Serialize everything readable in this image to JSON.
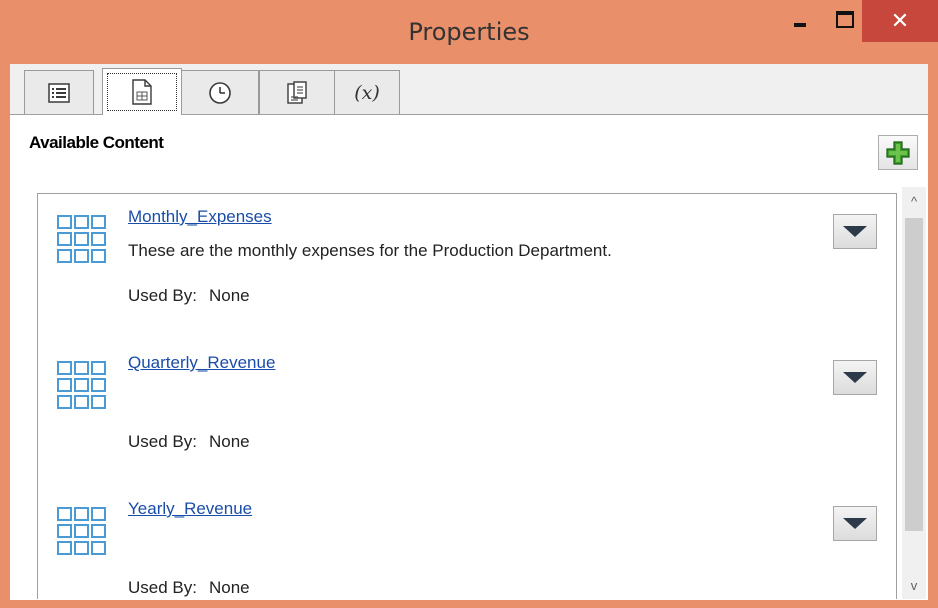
{
  "window": {
    "title": "Properties",
    "close_glyph": "✕",
    "buttons": [
      "minimize-icon",
      "maximize-icon",
      "close-icon"
    ]
  },
  "tabs": [
    {
      "icon": "list-icon",
      "active": false
    },
    {
      "icon": "table-document-icon",
      "active": true
    },
    {
      "icon": "clock-icon",
      "active": false
    },
    {
      "icon": "export-document-icon",
      "active": false
    },
    {
      "icon": "variable-icon",
      "label": "(x)",
      "active": false
    }
  ],
  "available_content": {
    "heading": "Available Content",
    "add_icon": "green-plus-icon",
    "accent_color": "#3a9a2a"
  },
  "items": [
    {
      "title": "Monthly_Expenses",
      "description": "These are the monthly expenses for the Production Department.",
      "used_by_label": "Used By:",
      "used_by_value": "None",
      "icon": "grid-icon"
    },
    {
      "title": "Quarterly_Revenue",
      "description": "",
      "used_by_label": "Used By:",
      "used_by_value": "None",
      "icon": "grid-icon"
    },
    {
      "title": "Yearly_Revenue",
      "description": "",
      "used_by_label": "Used By:",
      "used_by_value": "None",
      "icon": "grid-icon"
    }
  ],
  "scrollbar": {
    "up": "^",
    "down": "v"
  },
  "colors": {
    "titlebar": "#e9906a",
    "close_button": "#c7473d",
    "link": "#1a4da8",
    "icon_blue": "#4a9ad6"
  }
}
